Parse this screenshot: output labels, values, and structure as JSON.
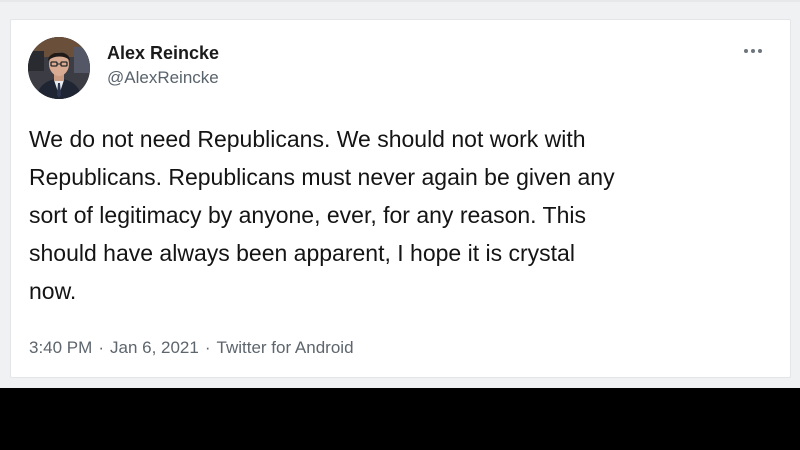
{
  "tweet": {
    "author": {
      "display_name": "Alex Reincke",
      "handle": "@AlexReincke",
      "avatar_icon": "profile-avatar-photo"
    },
    "more_icon": "more-options-icon",
    "text_lines": [
      "We do not need Republicans. We should not work with",
      "Republicans. Republicans must never again be given any",
      "sort of legitimacy by anyone, ever, for any reason. This",
      "should have always been apparent, I hope it is crystal",
      "now."
    ],
    "meta": {
      "time": "3:40 PM",
      "separator": "·",
      "date": "Jan 6, 2021",
      "source": "Twitter for Android"
    }
  },
  "colors": {
    "page_background": "#f0f1f2",
    "card_background": "#ffffff",
    "text_primary": "#141414",
    "text_secondary": "#5d656d",
    "letterbox": "#000000"
  }
}
